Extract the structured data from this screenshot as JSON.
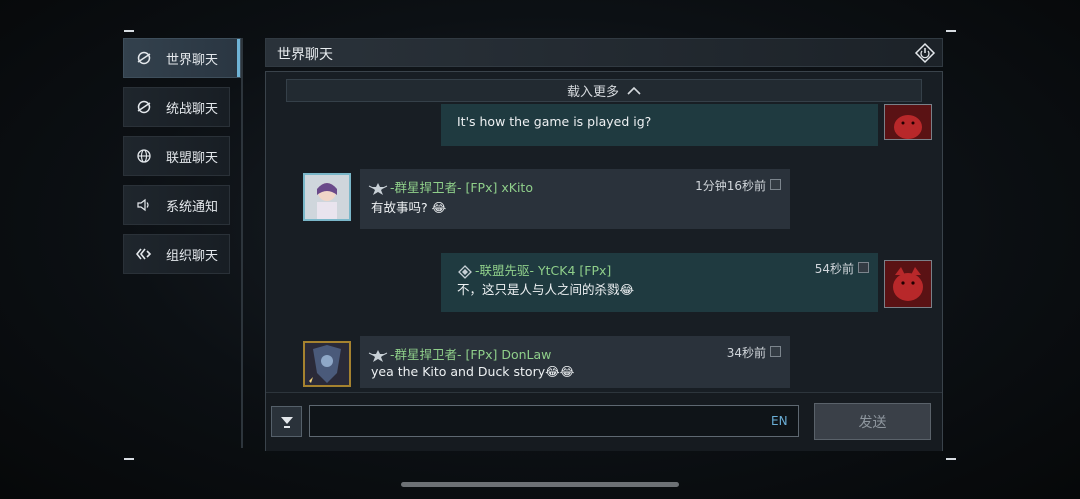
{
  "sidebar": {
    "items": [
      {
        "label": "世界聊天",
        "icon": "world-chat-icon",
        "active": true
      },
      {
        "label": "统战聊天",
        "icon": "united-chat-icon",
        "active": false
      },
      {
        "label": "联盟聊天",
        "icon": "globe-icon",
        "active": false
      },
      {
        "label": "系统通知",
        "icon": "speaker-icon",
        "active": false
      },
      {
        "label": "组织聊天",
        "icon": "organization-icon",
        "active": false
      }
    ]
  },
  "header": {
    "title": "世界聊天",
    "exit_icon": "exit-icon"
  },
  "chat": {
    "load_more": "载入更多",
    "messages": [
      {
        "text": "It's how the game is played ig?",
        "mine": true
      },
      {
        "name": "-群星捍卫者- [FPx] xKito",
        "time": "1分钟16秒前",
        "text": "有故事吗? 😂",
        "mine": false
      },
      {
        "name": "-联盟先驱- YtCK4 [FPx]",
        "time": "54秒前",
        "text": "不，这只是人与人之间的杀戮😂",
        "mine": true
      },
      {
        "name": "-群星捍卫者- [FPx] DonLaw",
        "time": "34秒前",
        "text": "yea the Kito and Duck story😂😂",
        "mine": false
      }
    ]
  },
  "input": {
    "value": "",
    "placeholder": "",
    "lang": "EN",
    "send_label": "发送"
  },
  "colors": {
    "accent": "#6fb3d6",
    "name_green": "#8fcf8a",
    "mine_bubble": "#1f3a40",
    "other_bubble": "#2a323b"
  }
}
